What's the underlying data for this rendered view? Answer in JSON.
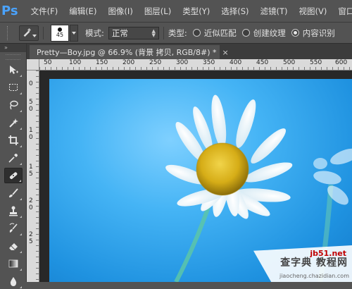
{
  "app": {
    "logo": "Ps"
  },
  "menu": [
    "文件(F)",
    "编辑(E)",
    "图像(I)",
    "图层(L)",
    "类型(Y)",
    "选择(S)",
    "滤镜(T)",
    "视图(V)",
    "窗口(W"
  ],
  "options": {
    "brush_size": "45",
    "mode_label": "模式:",
    "mode_value": "正常",
    "type_label": "类型:",
    "radios": [
      {
        "label": "近似匹配",
        "selected": false
      },
      {
        "label": "创建纹理",
        "selected": false
      },
      {
        "label": "内容识别",
        "selected": true
      }
    ]
  },
  "document": {
    "tab_title": "Pretty—Boy.jpg @ 66.9% (背景 拷贝, RGB/8#) *",
    "close_glyph": "×"
  },
  "rulers": {
    "h": [
      "50",
      "100",
      "150",
      "200",
      "250",
      "300",
      "350",
      "400",
      "450",
      "500",
      "550",
      "600"
    ],
    "v": [
      "0",
      "5",
      "0",
      "1",
      "0",
      "1",
      "5",
      "2",
      "0",
      "2",
      "5"
    ]
  },
  "toolbox": {
    "collapse": "»",
    "tools": [
      {
        "name": "move-tool-icon",
        "active": false
      },
      {
        "name": "marquee-tool-icon",
        "active": false
      },
      {
        "name": "lasso-tool-icon",
        "active": false
      },
      {
        "name": "magic-wand-tool-icon",
        "active": false
      },
      {
        "name": "crop-tool-icon",
        "active": false
      },
      {
        "name": "eyedropper-tool-icon",
        "active": false
      },
      {
        "name": "spot-healing-brush-tool-icon",
        "active": true
      },
      {
        "name": "brush-tool-icon",
        "active": false
      },
      {
        "name": "clone-stamp-tool-icon",
        "active": false
      },
      {
        "name": "history-brush-tool-icon",
        "active": false
      },
      {
        "name": "eraser-tool-icon",
        "active": false
      },
      {
        "name": "gradient-tool-icon",
        "active": false
      },
      {
        "name": "blur-tool-icon",
        "active": false
      }
    ]
  },
  "watermark": {
    "line1": "jb51.net",
    "line2": "查字典 教程网",
    "line3": "jiaocheng.chazidian.com"
  }
}
